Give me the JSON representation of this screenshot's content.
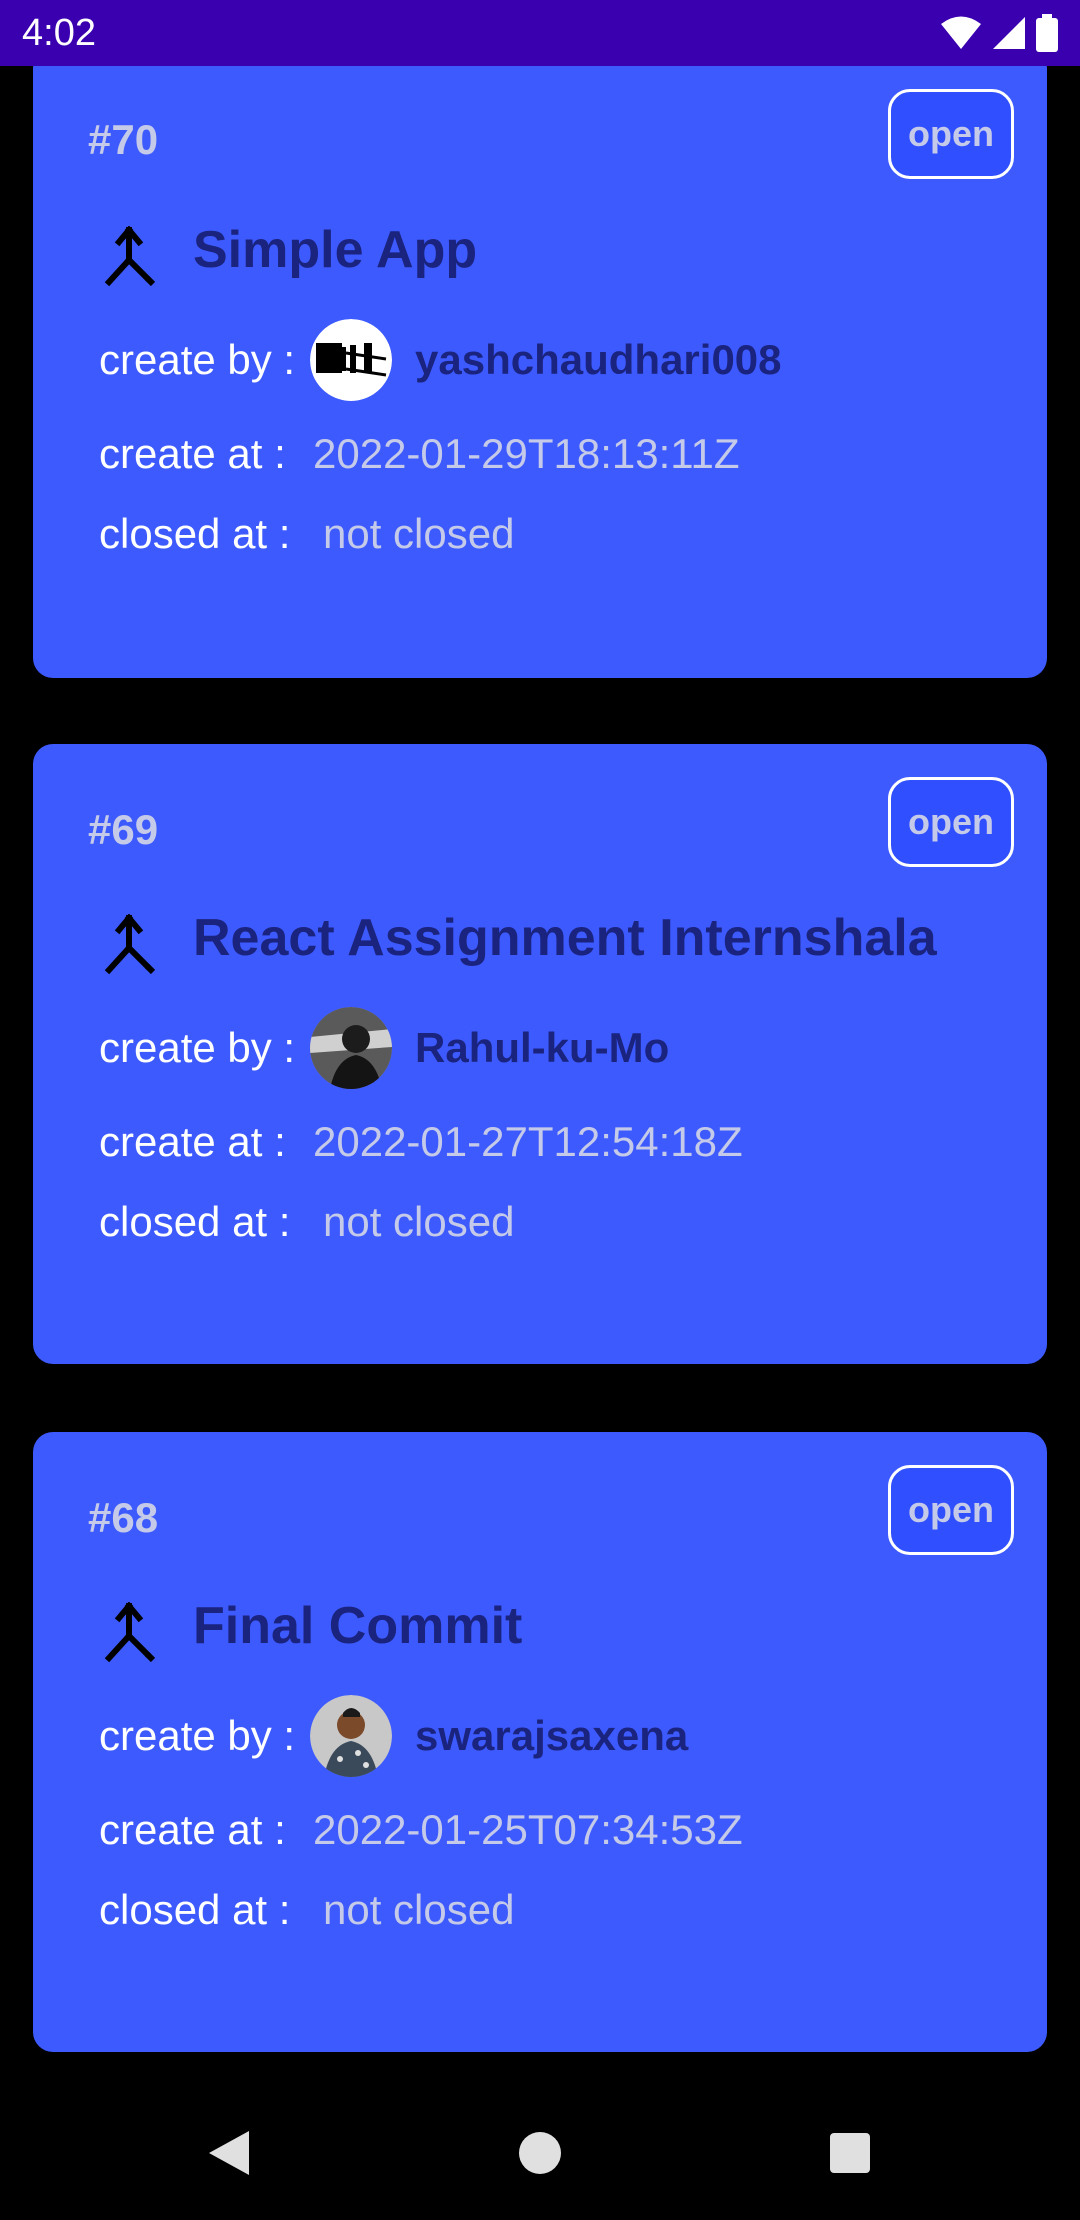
{
  "status_bar": {
    "time": "4:02"
  },
  "labels": {
    "create_by": "create by :",
    "create_at": "create at :",
    "closed_at": "closed at :"
  },
  "cards": [
    {
      "number": "#70",
      "state": "open",
      "title": "Simple App",
      "user": "yashchaudhari008",
      "created_at": "2022-01-29T18:13:11Z",
      "closed_at": "not closed"
    },
    {
      "number": "#69",
      "state": "open",
      "title": "React Assignment Internshala",
      "user": "Rahul-ku-Mo",
      "created_at": "2022-01-27T12:54:18Z",
      "closed_at": "not closed"
    },
    {
      "number": "#68",
      "state": "open",
      "title": "Final Commit",
      "user": "swarajsaxena",
      "created_at": "2022-01-25T07:34:53Z",
      "closed_at": "not closed"
    }
  ],
  "icons": {
    "merge": "merge-icon",
    "wifi": "wifi-icon",
    "signal": "signal-icon",
    "battery": "battery-icon",
    "back": "back-icon",
    "home": "home-icon",
    "recents": "recents-icon"
  },
  "colors": {
    "status_bar": "#3a00b0",
    "card": "#3d5afe",
    "chip": "#304ffe",
    "title": "#1a237e",
    "value": "#c5cae9"
  }
}
